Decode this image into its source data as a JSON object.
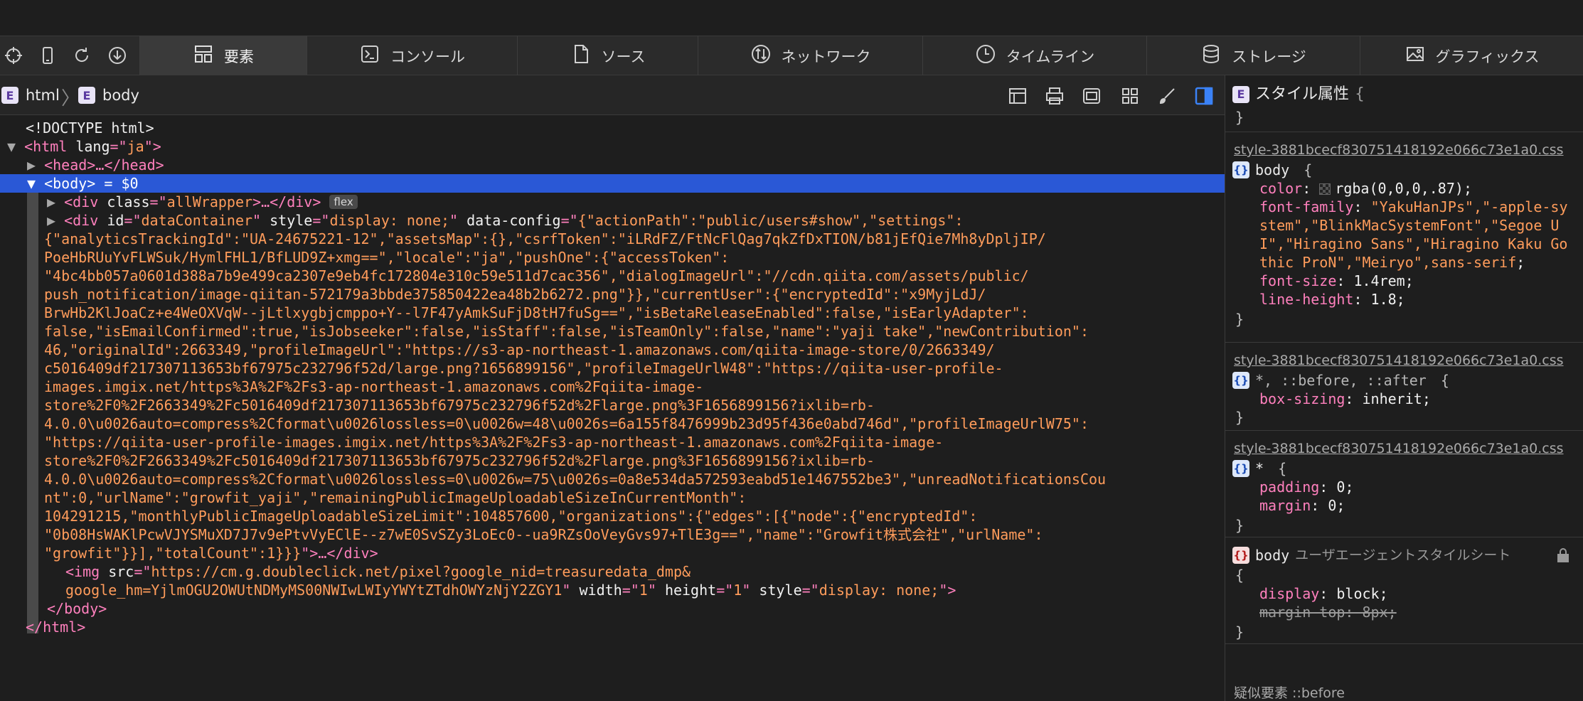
{
  "toolbar": {
    "tools": [
      {
        "icon": "crosshair-icon"
      },
      {
        "icon": "device-icon"
      },
      {
        "icon": "reload-icon"
      },
      {
        "icon": "download-icon"
      }
    ],
    "tabs": [
      {
        "label": "要素",
        "icon": "elements-icon",
        "active": true
      },
      {
        "label": "コンソール",
        "icon": "console-icon"
      },
      {
        "label": "ソース",
        "icon": "sources-icon"
      },
      {
        "label": "ネットワーク",
        "icon": "network-icon"
      },
      {
        "label": "タイムライン",
        "icon": "timeline-icon"
      },
      {
        "label": "ストレージ",
        "icon": "storage-icon"
      },
      {
        "label": "グラフィックス",
        "icon": "graphics-icon"
      }
    ]
  },
  "breadcrumb": {
    "badge": "E",
    "items": [
      "html",
      "body"
    ]
  },
  "dom": {
    "doctype": "<!DOCTYPE html>",
    "html_open": {
      "tag": "<html ",
      "attr": "lang",
      "eq": "=\"",
      "val": "ja",
      "end": "\">"
    },
    "head": "<head>…</head>",
    "body_open": "<body>",
    "body_selected_suffix": " = $0",
    "allwrapper": {
      "pre": "<div ",
      "attr": "class",
      "val": "allWrapper",
      "post": ">…</div>",
      "badge": "flex"
    },
    "datacontainer_head": {
      "pre": "<div ",
      "attr1": "id",
      "val1": "dataContainer",
      "attr2": "style",
      "val2": "display: none;",
      "attr3": "data-config",
      "val3_first": "{\"actionPath\":\"public/users#show\",\"settings\":"
    },
    "datacontainer_lines": [
      "{\"analyticsTrackingId\":\"UA-24675221-12\",\"assetsMap\":{},\"csrfToken\":\"iLRdFZ/FtNcFlQag7qkZfDxTION/b81jEfQie7Mh8yDpljIP/",
      "PoeHbRUuYvFLWSuk/HymlFHL1/BfLUD9Z+xmg==\",\"locale\":\"ja\",\"pushOne\":{\"accessToken\":",
      "\"4bc4bb057a0601d388a7b9e499ca2307e9eb4fc172804e310c59e511d7cac356\",\"dialogImageUrl\":\"//cdn.qiita.com/assets/public/",
      "push_notification/image-qiitan-572179a3bbde375850422ea48b2b6272.png\"}},\"currentUser\":{\"encryptedId\":\"x9MyjLdJ/",
      "BrwHb2KlJoaCz+e4WeOXVqW--jLtlxygbjcmppo+Y--l7F47yAmkSuFjD8tH7fuSg==\",\"isBetaReleaseEnabled\":false,\"isEarlyAdapter\":",
      "false,\"isEmailConfirmed\":true,\"isJobseeker\":false,\"isStaff\":false,\"isTeamOnly\":false,\"name\":\"yaji take\",\"newContribution\":",
      "46,\"originalId\":2663349,\"profileImageUrl\":\"https://s3-ap-northeast-1.amazonaws.com/qiita-image-store/0/2663349/",
      "c5016409df217307113653bf67975c232796f52d/large.png?1656899156\",\"profileImageUrlW48\":\"https://qiita-user-profile-",
      "images.imgix.net/https%3A%2F%2Fs3-ap-northeast-1.amazonaws.com%2Fqiita-image-",
      "store%2F0%2F2663349%2Fc5016409df217307113653bf67975c232796f52d%2Flarge.png%3F1656899156?ixlib=rb-",
      "4.0.0\\u0026auto=compress%2Cformat\\u0026lossless=0\\u0026w=48\\u0026s=6a155f8476999b23d95f436e0abd746d\",\"profileImageUrlW75\":",
      "\"https://qiita-user-profile-images.imgix.net/https%3A%2F%2Fs3-ap-northeast-1.amazonaws.com%2Fqiita-image-",
      "store%2F0%2F2663349%2Fc5016409df217307113653bf67975c232796f52d%2Flarge.png%3F1656899156?ixlib=rb-",
      "4.0.0\\u0026auto=compress%2Cformat\\u0026lossless=0\\u0026w=75\\u0026s=0a8e534da572593eabd51e1467552be3\",\"unreadNotificationsCou",
      "nt\":0,\"urlName\":\"growfit_yaji\",\"remainingPublicImageUploadableSizeInCurrentMonth\":",
      "104291215,\"monthlyPublicImageUploadableSizeLimit\":104857600,\"organizations\":{\"edges\":[{\"node\":{\"encryptedId\":",
      "\"0b08HsWAKlPcwVJYSMuXD7J7v9ePtvVyEClE--z7wE0SvSZy3LoEc0--ua9RZsOoVeyGvs97+TlE3g==\",\"name\":\"Growfit株式会社\",\"urlName\":",
      "\"growfit\"}}],\"totalCount\":1}}}"
    ],
    "datacontainer_tail": "\">…</div>",
    "img": {
      "pre": "<img ",
      "attr1": "src",
      "val1_a": "https://cm.g.doubleclick.net/pixel?google_nid=treasuredata_dmp&",
      "val1_b": "google_hm=YjlmOGU2OWUtNDMyMS00NWIwLWIyYWYtZTdhOWYzNjY2ZGY1",
      "attr2": "width",
      "val2": "1",
      "attr3": "height",
      "val3": "1",
      "attr4": "style",
      "val4": "display: none;",
      "post": "\">"
    },
    "body_close": "</body>",
    "html_close": "</html>"
  },
  "styles": {
    "header": {
      "badge": "E",
      "title": "スタイル属性",
      "open": "{",
      "close": "}"
    },
    "rules": [
      {
        "source": "style-3881bcecf830751418192e066c73e1a0.css",
        "selector": "body",
        "props": [
          {
            "name": "color",
            "value": "rgba(0,0,0,.87)",
            "swatch": true
          },
          {
            "name": "font-family",
            "value": "\"YakuHanJPs\",\"-apple-system\",\"BlinkMacSystemFont\",\"Segoe UI\",\"Hiragino Sans\",\"Hiragino Kaku Gothic ProN\",\"Meiryo\",sans-serif"
          },
          {
            "name": "font-size",
            "value": "1.4rem"
          },
          {
            "name": "line-height",
            "value": "1.8"
          }
        ]
      },
      {
        "source": "style-3881bcecf830751418192e066c73e1a0.css",
        "selector": "*, ::before, ::after",
        "props": [
          {
            "name": "box-sizing",
            "value": "inherit"
          }
        ]
      },
      {
        "source": "style-3881bcecf830751418192e066c73e1a0.css",
        "selector": "*",
        "props": [
          {
            "name": "padding",
            "value": "0"
          },
          {
            "name": "margin",
            "value": "0"
          }
        ]
      },
      {
        "selector": "body",
        "origin": "ユーザエージェントスタイルシート",
        "props": [
          {
            "name": "display",
            "value": "block"
          },
          {
            "name": "margin-top",
            "value": "8px",
            "overridden": true
          }
        ]
      }
    ],
    "pseudo_label": "疑似要素 ::before"
  },
  "colors": {
    "selection": "#2a58d6",
    "tag": "#ff80bd",
    "attr_value": "#ff9c5b",
    "background": "#1e1e1e"
  }
}
